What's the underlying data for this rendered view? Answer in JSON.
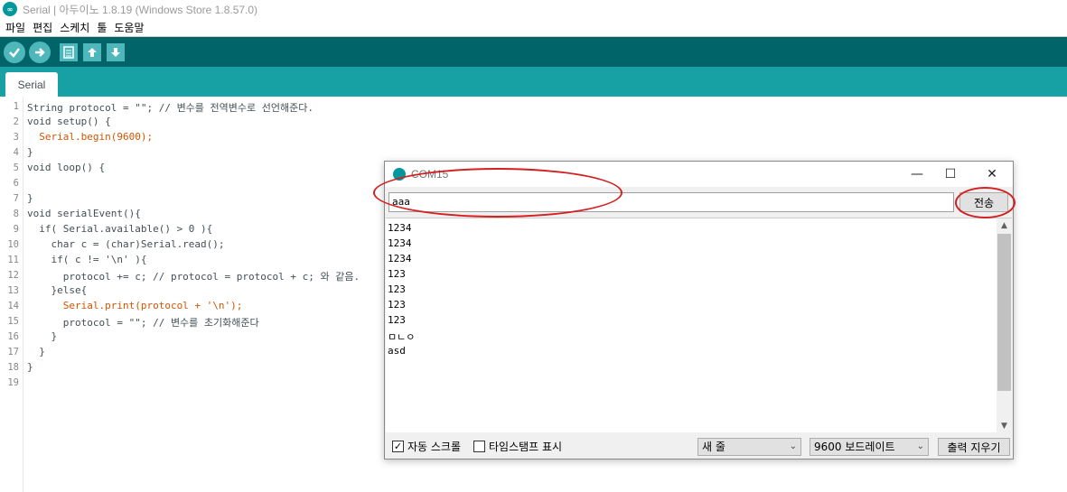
{
  "window": {
    "title": "Serial | 아두이노 1.8.19 (Windows Store 1.8.57.0)"
  },
  "menu": [
    "파일",
    "편집",
    "스케치",
    "툴",
    "도움말"
  ],
  "toolbar": {
    "buttons": [
      "verify-icon",
      "upload-icon",
      "new-icon",
      "open-icon",
      "save-icon"
    ]
  },
  "tab": {
    "label": "Serial"
  },
  "editor": {
    "line_numbers": [
      "1",
      "2",
      "3",
      "4",
      "5",
      "6",
      "7",
      "8",
      "9",
      "10",
      "11",
      "12",
      "13",
      "14",
      "15",
      "16",
      "17",
      "18",
      "19"
    ],
    "lines": [
      "String protocol = \"\"; // 변수를 전역변수로 선언해준다.",
      "void setup() {",
      "  Serial.begin(9600);",
      "}",
      "void loop() {",
      "",
      "}",
      "void serialEvent(){",
      "  if( Serial.available() > 0 ){",
      "    char c = (char)Serial.read();",
      "    if( c != '\\n' ){",
      "      protocol += c; // protocol = protocol + c; 와 같음.",
      "    }else{",
      "      Serial.print(protocol + '\\n');",
      "      protocol = \"\"; // 변수를 초기화해준다",
      "    }",
      "  }",
      "}",
      ""
    ]
  },
  "serial_monitor": {
    "title": "COM15",
    "minimize": "—",
    "maximize": "☐",
    "close": "✕",
    "input_value": "aaa",
    "send_label": "전송",
    "output_lines": [
      "1234",
      "1234",
      "1234",
      "123",
      "123",
      "123",
      "123",
      "ㅁㄴㅇ",
      "asd"
    ],
    "autoscroll_checked": "✓",
    "autoscroll_label": "자동 스크롤",
    "timestamp_label": "타임스탬프 표시",
    "line_ending": "새 줄",
    "baud_rate": "9600 보드레이트",
    "clear_label": "출력 지우기"
  },
  "colors": {
    "toolbar": "#006468",
    "tabbar": "#17a1a5",
    "annotation": "#d42020"
  }
}
